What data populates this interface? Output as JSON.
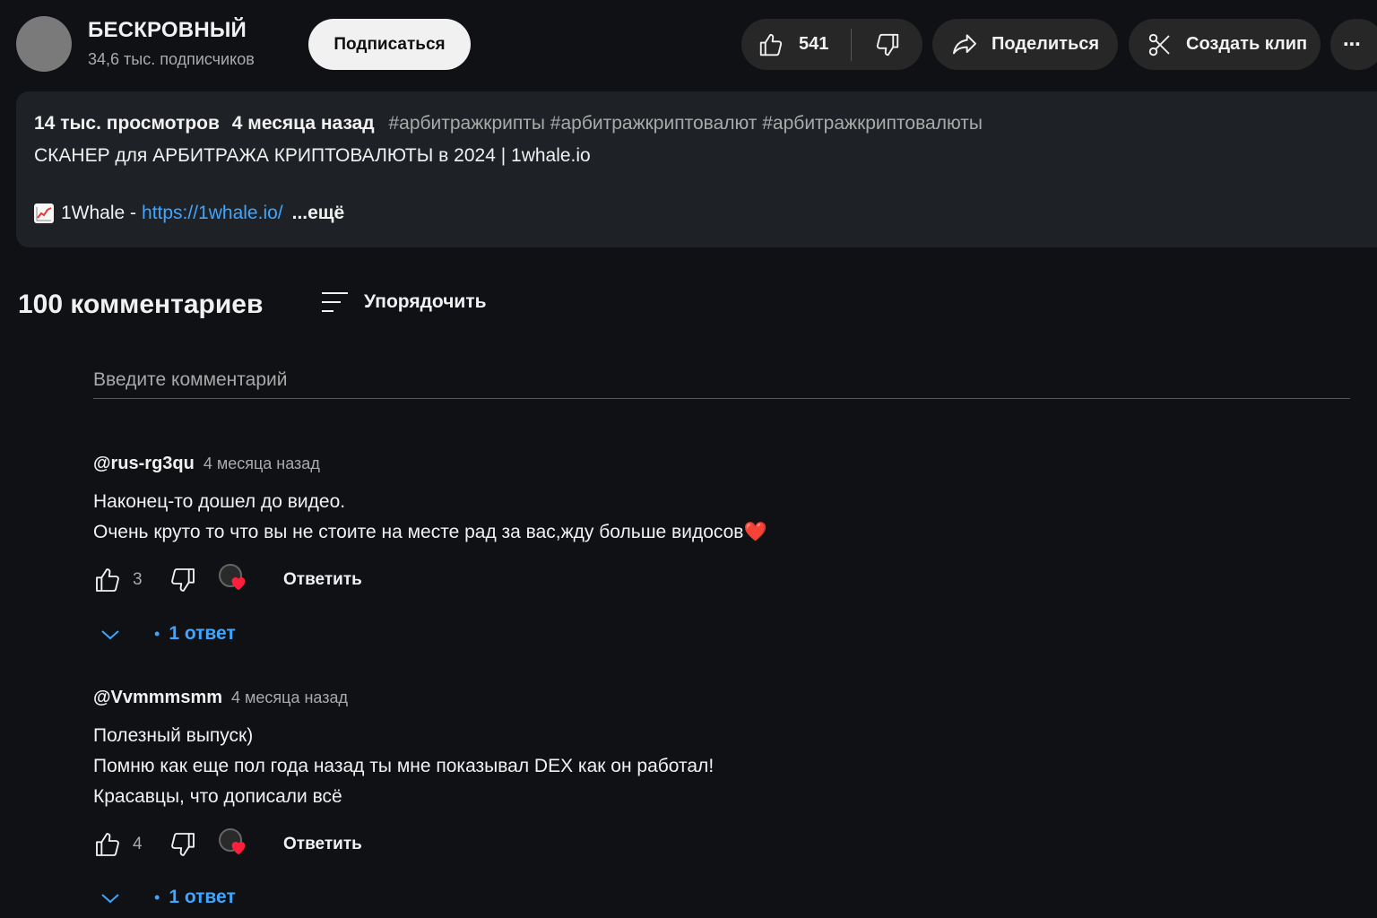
{
  "channel": {
    "name": "БЕСКРОВНЫЙ",
    "subscribers": "34,6 тыс. подписчиков",
    "subscribe_label": "Подписаться"
  },
  "actions": {
    "like_count": "541",
    "share_label": "Поделиться",
    "clip_label": "Создать клип",
    "more_label": "⋯",
    "like_icon": "thumbs-up-icon",
    "dislike_icon": "thumbs-down-icon",
    "share_icon": "share-arrow-icon",
    "clip_icon": "scissors-icon",
    "more_icon": "more-horizontal-icon"
  },
  "description": {
    "views": "14 тыс. просмотров",
    "date": "4 месяца назад",
    "tags": "#арбитражкрипты #арбитражкриптовалют #арбитражкриптовалюты",
    "title": "СКАНЕР для АРБИТРАЖА КРИПТОВАЛЮТЫ в 2024 | 1whale.io",
    "link_prefix": "1Whale -",
    "link": "https://1whale.io/",
    "more": "...ещё",
    "link_emoji_icon": "chart-increasing-icon"
  },
  "comments_section": {
    "count_label": "100 комментариев",
    "sort_label": "Упорядочить",
    "input_placeholder": "Введите комментарий",
    "reply_label": "Ответить",
    "comments": [
      {
        "author": "@rus-rg3qu",
        "time": "4 месяца назад",
        "line1": "Наконец-то дошел до видео.",
        "line2": "Очень круто то что вы не стоите на месте рад за вас,жду больше видосов",
        "line2_emoji": "❤️",
        "likes": "3",
        "replies_label": "1 ответ"
      },
      {
        "author": "@Vvmmmsmm",
        "time": "4 месяца назад",
        "line1": "Полезный выпуск)",
        "line2": "Помню как еще пол года назад ты мне показывал DEX как он работал!",
        "line3": "Красавцы, что дописали всё",
        "likes": "4",
        "replies_label": "1 ответ"
      }
    ]
  },
  "colors": {
    "background": "#0f1115",
    "panel": "#1e2126",
    "pill": "#272727",
    "link": "#3ea6ff",
    "heart": "#ff3040"
  }
}
